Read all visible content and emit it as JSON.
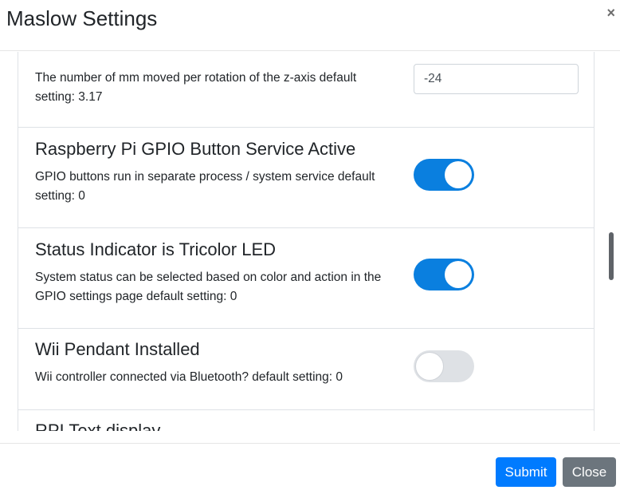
{
  "modal": {
    "title": "Maslow Settings",
    "close_glyph": "×"
  },
  "settings": [
    {
      "title": "",
      "description": "The number of mm moved per rotation of the z-axis default setting: 3.17",
      "control": "input",
      "value": "-24"
    },
    {
      "title": "Raspberry Pi GPIO Button Service Active",
      "description": "GPIO buttons run in separate process / system service default setting: 0",
      "control": "toggle",
      "checked": true
    },
    {
      "title": "Status Indicator is Tricolor LED",
      "description": "System status can be selected based on color and action in the GPIO settings page default setting: 0",
      "control": "toggle",
      "checked": true
    },
    {
      "title": "Wii Pendant Installed",
      "description": "Wii controller connected via Bluetooth? default setting: 0",
      "control": "toggle",
      "checked": false
    },
    {
      "title": "RPI Text display",
      "description": "",
      "control": "none"
    }
  ],
  "footer": {
    "submit_label": "Submit",
    "close_label": "Close"
  },
  "colors": {
    "toggle_on": "#0a7fdf",
    "toggle_off": "#dee1e5",
    "primary": "#007bff",
    "secondary": "#6c757d"
  }
}
